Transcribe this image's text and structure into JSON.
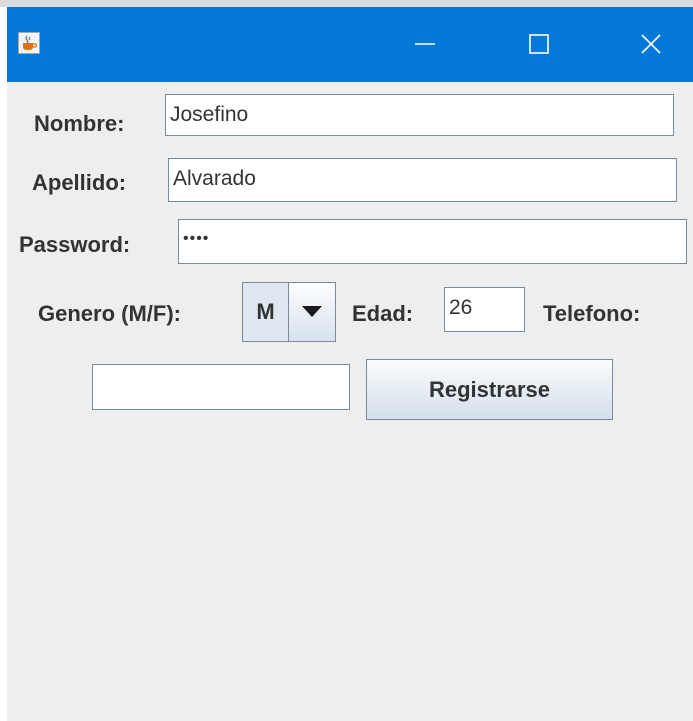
{
  "window": {
    "title": "",
    "icon": "java-coffee-icon",
    "controls": {
      "minimize_icon": "minimize-icon",
      "maximize_icon": "maximize-icon",
      "close_icon": "close-icon"
    },
    "titlebar_color": "#0378d7",
    "background_color": "#eeeeee"
  },
  "form": {
    "nombre_label": "Nombre:",
    "nombre_value": "Josefino",
    "apellido_label": "Apellido:",
    "apellido_value": "Alvarado",
    "password_label": "Password:",
    "password_mask": "••••",
    "genero_label": "Genero (M/F):",
    "genero_value": "M",
    "edad_label": "Edad:",
    "edad_value": "26",
    "telefono_label": "Telefono:",
    "telefono_value": "",
    "register_button": "Registrarse"
  }
}
